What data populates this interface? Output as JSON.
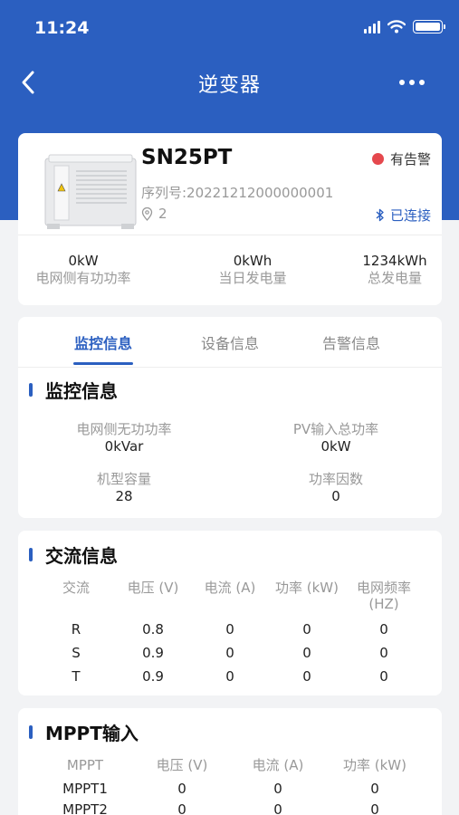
{
  "status_bar": {
    "time": "11:24"
  },
  "nav": {
    "title": "逆变器"
  },
  "device": {
    "name": "SN25PT",
    "alarm_label": "有告警",
    "serial": "序列号:20221212000000001",
    "location": "2",
    "connection": "已连接",
    "stats": [
      {
        "value": "0kW",
        "label": "电网侧有功功率"
      },
      {
        "value": "0kWh",
        "label": "当日发电量"
      },
      {
        "value": "1234kWh",
        "label": "总发电量"
      }
    ]
  },
  "tabs": [
    {
      "label": "监控信息",
      "active": true
    },
    {
      "label": "设备信息",
      "active": false
    },
    {
      "label": "告警信息",
      "active": false
    }
  ],
  "monitor": {
    "title": "监控信息",
    "items": [
      {
        "label": "电网侧无功功率",
        "value": "0kVar"
      },
      {
        "label": "PV输入总功率",
        "value": "0kW"
      },
      {
        "label": "机型容量",
        "value": "28"
      },
      {
        "label": "功率因数",
        "value": "0"
      }
    ]
  },
  "ac": {
    "title": "交流信息",
    "headers": [
      "交流",
      "电压 (V)",
      "电流 (A)",
      "功率 (kW)",
      "电网频率\n(HZ)"
    ],
    "rows": [
      [
        "R",
        "0.8",
        "0",
        "0",
        "0"
      ],
      [
        "S",
        "0.9",
        "0",
        "0",
        "0"
      ],
      [
        "T",
        "0.9",
        "0",
        "0",
        "0"
      ]
    ]
  },
  "mppt": {
    "title": "MPPT输入",
    "headers": [
      "MPPT",
      "电压 (V)",
      "电流 (A)",
      "功率 (kW)"
    ],
    "rows": [
      [
        "MPPT1",
        "0",
        "0",
        "0"
      ],
      [
        "MPPT2",
        "0",
        "0",
        "0"
      ]
    ]
  },
  "colors": {
    "accent": "#2b5fc0",
    "alarm": "#e5484d"
  }
}
